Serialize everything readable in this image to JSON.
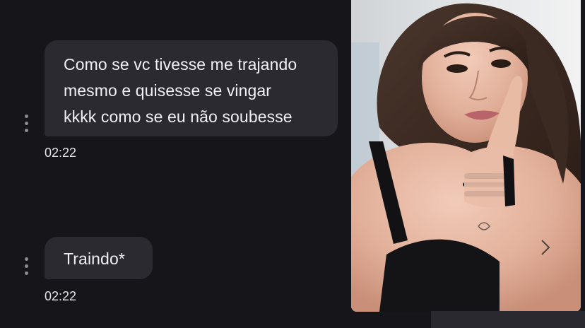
{
  "messages": [
    {
      "text": "Como se vc tivesse me trajando\nmesmo e quisesse se vingar\nkkkk como se eu não soubesse",
      "time": "02:22"
    },
    {
      "text": "Traindo*",
      "time": "02:22"
    }
  ],
  "attachment": {
    "type": "photo",
    "description_icon": "photo-icon"
  },
  "colors": {
    "background": "#16151a",
    "bubble": "#2b2a31",
    "bubble_text": "#f1f0f4",
    "timestamp": "#e4e3e8",
    "menu_dots": "#8c8b92"
  }
}
